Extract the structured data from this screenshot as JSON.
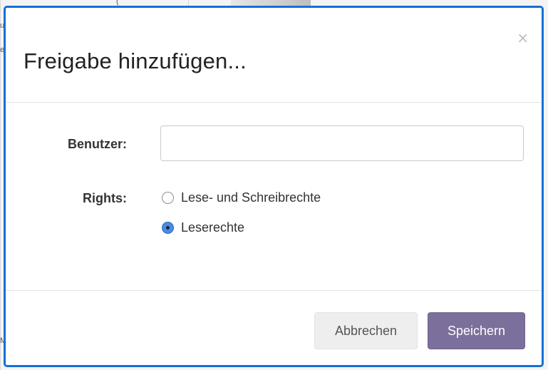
{
  "dialog": {
    "title": "Freigabe hinzufügen...",
    "close_symbol": "×"
  },
  "form": {
    "user_label": "Benutzer:",
    "user_value": "",
    "user_placeholder": "",
    "rights_label": "Rights:",
    "rights_options": [
      {
        "label": "Lese- und Schreibrechte",
        "checked": false
      },
      {
        "label": "Leserechte",
        "checked": true
      }
    ]
  },
  "footer": {
    "cancel_label": "Abbrechen",
    "save_label": "Speichern"
  },
  "colors": {
    "accent_border": "#1570d8",
    "primary_button": "#7c6f9b",
    "radio_checked": "#4b8be0"
  },
  "background": {
    "partial_letters": [
      "(",
      "u",
      "e",
      "M"
    ]
  }
}
